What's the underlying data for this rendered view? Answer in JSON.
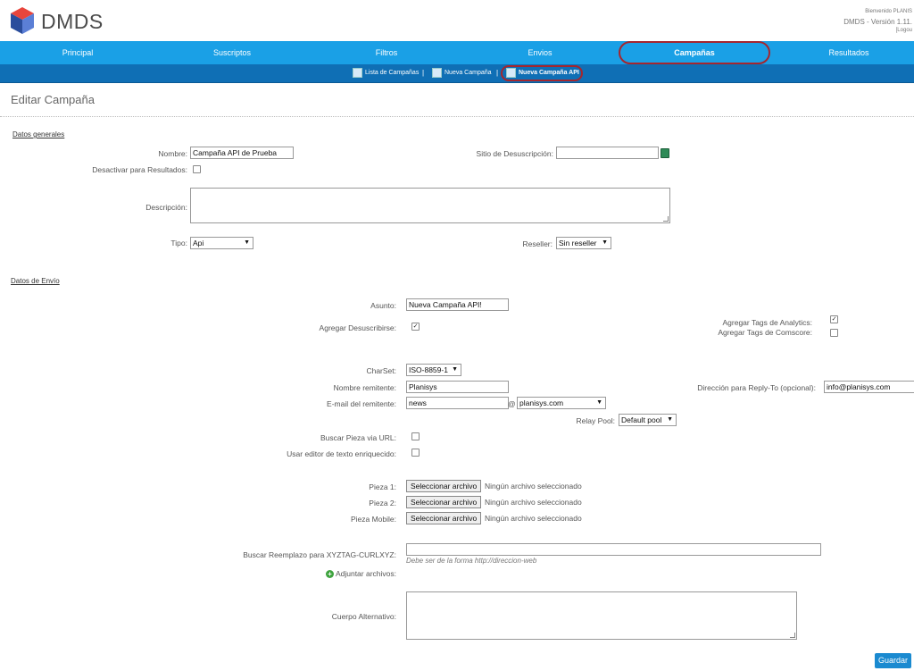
{
  "app": {
    "logo_text": "DMDS",
    "welcome": "Bienvenido PLANIS",
    "version": "DMDS - Versión 1.11.",
    "logout": "[Logou"
  },
  "nav": {
    "items": [
      "Principal",
      "Suscriptos",
      "Filtros",
      "Envios",
      "Campañas",
      "Resultados"
    ],
    "active": "Campañas"
  },
  "subnav": {
    "items": [
      "Lista de Campañas",
      "Nueva Campaña",
      "Nueva Campaña API"
    ],
    "separator": "|"
  },
  "page": {
    "title": "Editar Campaña"
  },
  "general": {
    "section": "Datos generales",
    "nombre_label": "Nombre:",
    "nombre_value": "Campaña API de Prueba",
    "sitio_label": "Sitio de Desuscripción:",
    "sitio_value": "",
    "desactivar_label": "Desactivar para Resultados:",
    "descripcion_label": "Descripción:",
    "tipo_label": "Tipo:",
    "tipo_value": "Api",
    "reseller_label": "Reseller:",
    "reseller_value": "Sin reseller"
  },
  "envio": {
    "section": "Datos de Envío",
    "asunto_label": "Asunto:",
    "asunto_value": "Nueva Campaña API!",
    "desuscribirse_label": "Agregar Desuscribirse:",
    "analytics_label": "Agregar Tags de Analytics:",
    "comscore_label": "Agregar Tags de Comscore:",
    "charset_label": "CharSet:",
    "charset_value": "ISO-8859-1",
    "remitente_label": "Nombre remitente:",
    "remitente_value": "Planisys",
    "replyto_label": "Dirección para Reply-To (opcional):",
    "replyto_value": "info@planisys.com",
    "email_label": "E-mail del remitente:",
    "email_value": "news",
    "at": "@",
    "domain_value": "planisys.com",
    "relay_label": "Relay Pool:",
    "relay_value": "Default pool",
    "buscar_url_label": "Buscar Pieza via URL:",
    "editor_label": "Usar editor de texto enriquecido:",
    "pieza1_label": "Pieza 1:",
    "pieza2_label": "Pieza 2:",
    "pieza_mobile_label": "Pieza Mobile:",
    "file_button": "Seleccionar archivo",
    "file_none": "Ningún archivo seleccionado",
    "reemplazo_label": "Buscar Reemplazo para XYZTAG-CURLXYZ:",
    "reemplazo_hint": "Debe ser de la forma http://direccion-web",
    "adjuntar_label": "Adjuntar archivos:",
    "cuerpo_label": "Cuerpo Alternativo:",
    "save_button": "Guardar"
  }
}
